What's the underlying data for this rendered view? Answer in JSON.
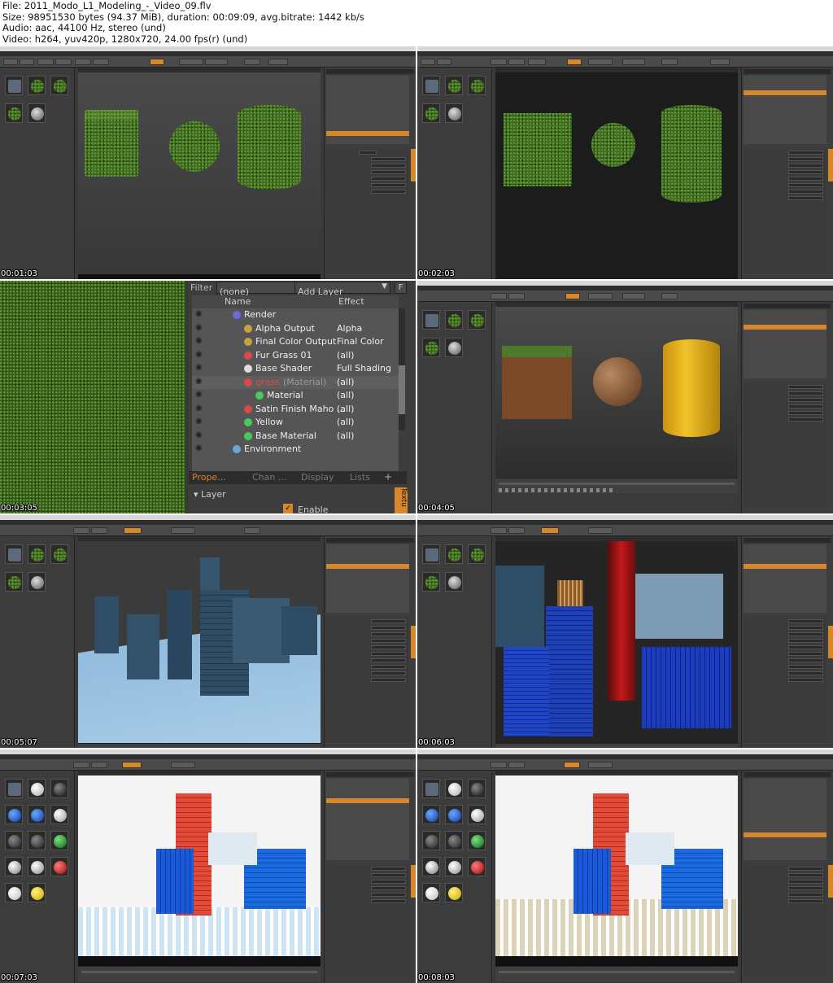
{
  "file_info": {
    "file": "File: 2011_Modo_L1_Modeling_-_Video_09.flv",
    "size": "Size: 98951530 bytes (94.37 MiB), duration: 00:09:09, avg.bitrate: 1442 kb/s",
    "audio": "Audio: aac, 44100 Hz, stereo (und)",
    "video": "Video: h264, yuv420p, 1280x720, 24.00 fps(r) (und)"
  },
  "timestamps": [
    "00:01:03",
    "00:02:03",
    "00:03:05",
    "00:04:05",
    "00:05:07",
    "00:06:03",
    "00:07:03",
    "00:08:03"
  ],
  "zoom_panel": {
    "filter_label": "Filter",
    "filter_value": "(none)",
    "add_layer": "Add Layer",
    "f_button": "F",
    "col_name": "Name",
    "col_effect": "Effect",
    "rows": [
      {
        "name": "Render",
        "effect": ""
      },
      {
        "name": "Alpha Output",
        "effect": "Alpha"
      },
      {
        "name": "Final Color Output",
        "effect": "Final Color"
      },
      {
        "name": "Fur Grass 01",
        "effect": "(all)"
      },
      {
        "name": "Base Shader",
        "effect": "Full Shading"
      },
      {
        "name": "grass",
        "extra": "(Material)",
        "effect": "(all)"
      },
      {
        "name": "Material",
        "effect": "(all)"
      },
      {
        "name": "Satin Finish Maho ...",
        "effect": "(all)"
      },
      {
        "name": "Yellow",
        "effect": "(all)"
      },
      {
        "name": "Base Material",
        "effect": "(all)"
      },
      {
        "name": "Environment",
        "effect": ""
      }
    ],
    "tabs": [
      "Prope...",
      "Chan ...",
      "Display",
      "Lists",
      "+"
    ],
    "layer_label": "Layer",
    "enable_label": "Enable",
    "side_tab": "Textu"
  },
  "colors": {
    "accent": "#d8862a",
    "panel": "#3d3d3d",
    "selection": "#d8862a"
  }
}
